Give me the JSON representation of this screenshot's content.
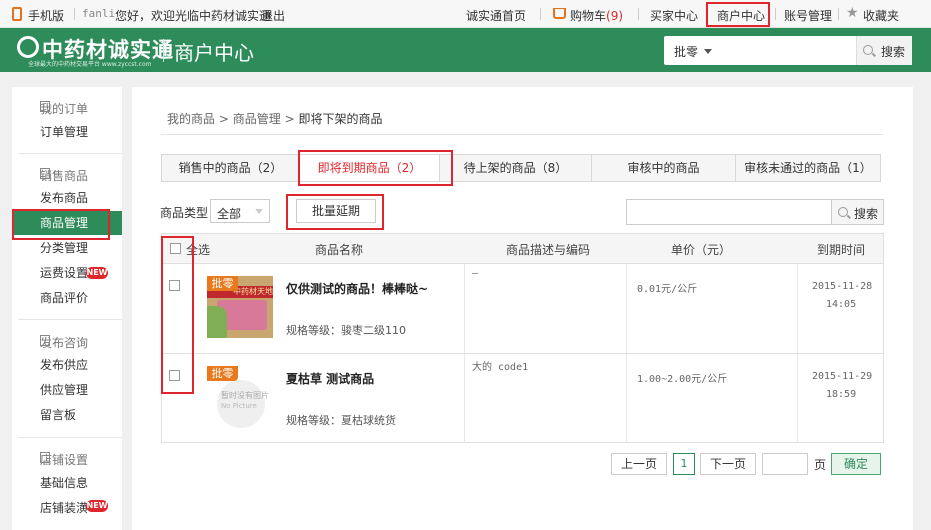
{
  "topbar": {
    "mobile": "手机版",
    "username": "fanli",
    "greeting": "您好，欢迎光临中药材诚实通",
    "logout": "退出",
    "home": "诚实通首页",
    "cart_label": "购物车",
    "cart_count": "(9)",
    "buyer_center": "买家中心",
    "merchant_center": "商户中心",
    "account": "账号管理",
    "favorites": "收藏夹"
  },
  "header": {
    "logo_text": "中药材诚实通",
    "logo_sub": "全球最大的中药材交易平台 www.zyccst.com",
    "title": "商户中心",
    "search_scope": "批零",
    "search_button": "搜索"
  },
  "sidebar": {
    "groups": [
      {
        "title": "我的订单",
        "items": [
          "订单管理"
        ]
      },
      {
        "title": "销售商品",
        "items": [
          "发布商品",
          "商品管理",
          "分类管理",
          "运费设置",
          "商品评价"
        ]
      },
      {
        "title": "发布咨询",
        "items": [
          "发布供应",
          "供应管理",
          "留言板"
        ]
      },
      {
        "title": "店铺设置",
        "items": [
          "基础信息",
          "店铺装潢"
        ]
      }
    ],
    "new_badge": "NEW"
  },
  "breadcrumb": [
    "我的商品",
    "商品管理",
    "即将下架的商品"
  ],
  "tabs": [
    {
      "label": "销售中的商品（2）"
    },
    {
      "label": "即将到期商品（2）"
    },
    {
      "label": "待上架的商品（8）"
    },
    {
      "label": "审核中的商品"
    },
    {
      "label": "审核未通过的商品（1）"
    }
  ],
  "filters": {
    "type_label": "商品类型",
    "type_value": "全部",
    "batch_extend": "批量延期",
    "search_button": "搜索"
  },
  "table": {
    "headers": [
      "全选",
      "商品名称",
      "商品描述与编码",
      "单价（元）",
      "到期时间"
    ],
    "rows": [
      {
        "tag": "批零",
        "thumb_text": "中药材天地",
        "name": "仅供测试的商品！棒棒哒~",
        "spec": "规格等级：骏枣二级110",
        "desc": "—",
        "price": "0.01元/公斤",
        "expire_date": "2015-11-28",
        "expire_time": "14:05"
      },
      {
        "tag": "批零",
        "thumb_text": "暂时没有图片",
        "thumb_text2": "No Picture",
        "name": "夏枯草 测试商品",
        "spec": "规格等级：夏枯球统货",
        "desc": "大的 code1",
        "price": "1.00~2.00元/公斤",
        "expire_date": "2015-11-29",
        "expire_time": "18:59"
      }
    ]
  },
  "pager": {
    "prev": "上一页",
    "current": "1",
    "next": "下一页",
    "unit": "页",
    "confirm": "确定"
  },
  "colors": {
    "brand_green": "#2e8b5a",
    "accent_red": "#e0262d",
    "tag_orange": "#e8791c"
  }
}
